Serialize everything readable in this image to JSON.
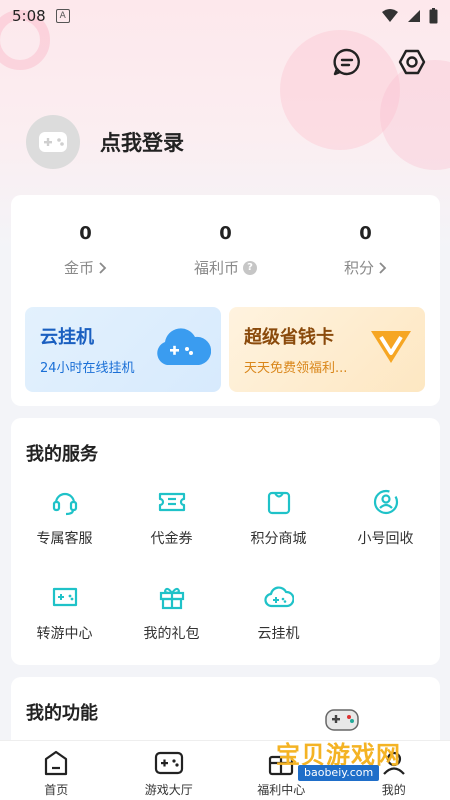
{
  "status_bar": {
    "time": "5:08",
    "notif_icon": "A"
  },
  "profile": {
    "login_label": "点我登录"
  },
  "stats": [
    {
      "value": "0",
      "label": "金币",
      "suffix": "chevron"
    },
    {
      "value": "0",
      "label": "福利币",
      "suffix": "question"
    },
    {
      "value": "0",
      "label": "积分",
      "suffix": "chevron"
    }
  ],
  "promos": {
    "cloud": {
      "title": "云挂机",
      "subtitle": "24小时在线挂机"
    },
    "vip": {
      "title": "超级省钱卡",
      "subtitle": "天天免费领福利..."
    }
  },
  "services": {
    "title": "我的服务",
    "items": [
      {
        "label": "专属客服",
        "icon": "headset-icon"
      },
      {
        "label": "代金券",
        "icon": "coupon-icon"
      },
      {
        "label": "积分商城",
        "icon": "shopping-bag-icon"
      },
      {
        "label": "小号回收",
        "icon": "recycle-user-icon"
      },
      {
        "label": "转游中心",
        "icon": "transfer-game-icon"
      },
      {
        "label": "我的礼包",
        "icon": "gift-icon"
      },
      {
        "label": "云挂机",
        "icon": "cloud-game-icon"
      }
    ]
  },
  "functions": {
    "title": "我的功能"
  },
  "tabs": [
    {
      "label": "首页",
      "icon": "home-icon"
    },
    {
      "label": "游戏大厅",
      "icon": "gamepad-icon"
    },
    {
      "label": "福利中心",
      "icon": "gift-box-icon"
    },
    {
      "label": "我的",
      "icon": "user-icon"
    }
  ],
  "watermark": {
    "text": "宝贝游戏网",
    "url": "baobeiy.com"
  },
  "colors": {
    "accent": "#1fc2c8",
    "promo_blue": "#1a6fd6",
    "promo_orange": "#d9861a"
  }
}
